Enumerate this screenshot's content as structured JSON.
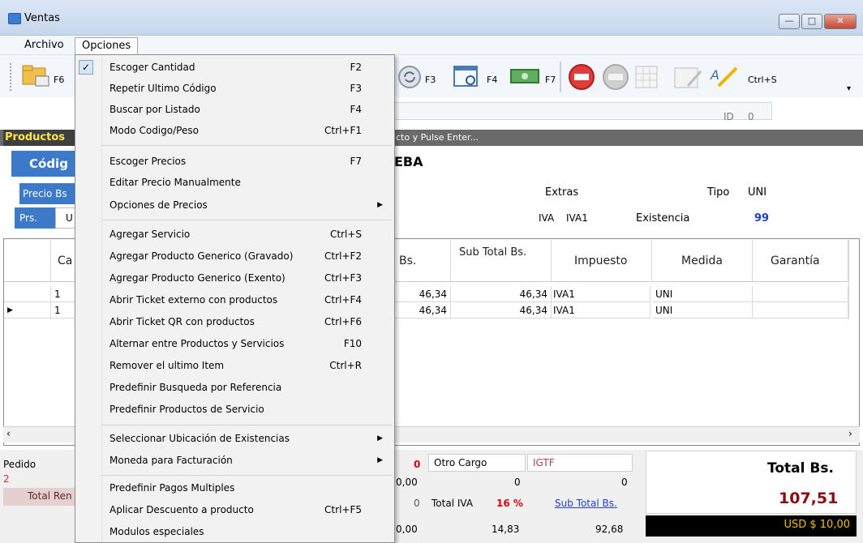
{
  "window": {
    "title": "Ventas",
    "min": "—",
    "max": "□",
    "close": "✕"
  },
  "menubar": {
    "archivo": "Archivo",
    "opciones": "Opciones"
  },
  "toolbar": {
    "f6": "F6",
    "f3": "F3",
    "f4": "F4",
    "f7": "F7",
    "ctrls": "Ctrl+S"
  },
  "id": {
    "label": "ID",
    "value": "0"
  },
  "products": {
    "tab": "Productos",
    "placeholder_hint": "cto y Pulse Enter...",
    "codigo": "Códig",
    "name": "EBA",
    "precio": "Precio Bs",
    "prs": "Prs.",
    "prs_value": "U",
    "extras": "Extras",
    "tipo_label": "Tipo",
    "tipo_value": "UNI",
    "iva_label": "IVA",
    "iva_value": "IVA1",
    "existencia_label": "Existencia",
    "existencia_value": "99"
  },
  "table": {
    "headers": {
      "ca": "Ca",
      "precio": "Bs.",
      "subtotal": "Sub Total Bs.",
      "impuesto": "Impuesto",
      "medida": "Medida",
      "garantia": "Garantía"
    },
    "rows": [
      {
        "cant": "1",
        "precio": "46,34",
        "subtotal": "46,34",
        "impuesto": "IVA1",
        "medida": "UNI"
      },
      {
        "cant": "1",
        "precio": "46,34",
        "subtotal": "46,34",
        "impuesto": "IVA1",
        "medida": "UNI"
      }
    ]
  },
  "footer": {
    "pedido_label": "Pedido",
    "pedido_value": "2",
    "total_ren": "Total Ren",
    "zero_red": "0",
    "otro_cargo": "Otro Cargo",
    "igtf": "IGTF",
    "v1": "0,00",
    "v2": "0",
    "v3": "0",
    "v4": "0",
    "total_iva": "Total IVA",
    "iva_pct": "16 %",
    "sub_total_link": "Sub Total Bs.",
    "v5": "0,00",
    "v6": "14,83",
    "v7": "92,68",
    "total_bs_label": "Total Bs.",
    "total_bs_value": "107,51",
    "usd": "USD $ 10,00"
  },
  "menu": {
    "items": [
      {
        "label": "Escoger Cantidad",
        "shortcut": "F2",
        "checked": "✓"
      },
      {
        "label": "Repetir Ultimo Código",
        "shortcut": "F3"
      },
      {
        "label": "Buscar por Listado",
        "shortcut": "F4"
      },
      {
        "label": "Modo Codigo/Peso",
        "shortcut": "Ctrl+F1"
      },
      {
        "label": "Escoger Precios",
        "shortcut": "F7"
      },
      {
        "label": "Editar Precio Manualmente",
        "shortcut": ""
      },
      {
        "label": "Opciones de Precios",
        "arrow": "▶"
      },
      {
        "label": "Agregar Servicio",
        "shortcut": "Ctrl+S"
      },
      {
        "label": "Agregar Producto Generico (Gravado)",
        "shortcut": "Ctrl+F2"
      },
      {
        "label": "Agregar Producto Generico (Exento)",
        "shortcut": "Ctrl+F3"
      },
      {
        "label": "Abrir Ticket externo con productos",
        "shortcut": "Ctrl+F4"
      },
      {
        "label": "Abrir Ticket QR con productos",
        "shortcut": "Ctrl+F6"
      },
      {
        "label": "Alternar entre  Productos y Servicios",
        "shortcut": "F10"
      },
      {
        "label": "Remover el ultimo Item",
        "shortcut": "Ctrl+R"
      },
      {
        "label": "Predefinir Busqueda por Referencia",
        "shortcut": ""
      },
      {
        "label": "Predefinir Productos de Servicio",
        "shortcut": ""
      },
      {
        "label": "Seleccionar Ubicación de Existencias",
        "arrow": "▶"
      },
      {
        "label": "Moneda para Facturación",
        "arrow": "▶"
      },
      {
        "label": "Predefinir Pagos Multiples",
        "shortcut": ""
      },
      {
        "label": "Aplicar Descuento a producto",
        "shortcut": "Ctrl+F5"
      },
      {
        "label": "Modulos especiales",
        "shortcut": ""
      }
    ]
  }
}
